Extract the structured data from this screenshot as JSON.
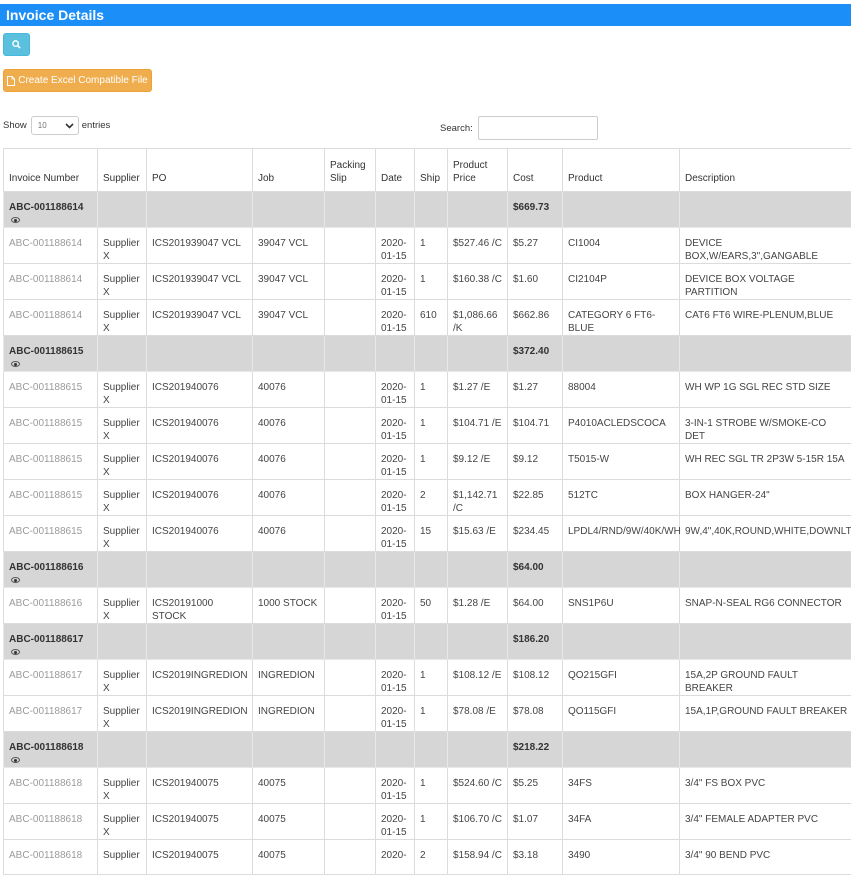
{
  "header": {
    "title": "Invoice Details"
  },
  "toolbar": {
    "excel_label": "Create Excel Compatible File"
  },
  "controls": {
    "show_label": "Show",
    "entries_value": "10",
    "entries_label": "entries",
    "search_label": "Search:"
  },
  "table": {
    "columns": [
      "Invoice Number",
      "Supplier",
      "PO",
      "Job",
      "Packing Slip",
      "Date",
      "Ship",
      "Product Price",
      "Cost",
      "Product",
      "Description"
    ],
    "groups": [
      {
        "invoice": "ABC-001188614",
        "total": "$669.73",
        "rows": [
          [
            "ABC-001188614",
            "Supplier X",
            "ICS201939047 VCL",
            "39047 VCL",
            "",
            "2020-01-15",
            "1",
            "$527.46 /C",
            "$5.27",
            "CI1004",
            "DEVICE BOX,W/EARS,3\",GANGABLE"
          ],
          [
            "ABC-001188614",
            "Supplier X",
            "ICS201939047 VCL",
            "39047 VCL",
            "",
            "2020-01-15",
            "1",
            "$160.38 /C",
            "$1.60",
            "CI2104P",
            "DEVICE BOX VOLTAGE PARTITION"
          ],
          [
            "ABC-001188614",
            "Supplier X",
            "ICS201939047 VCL",
            "39047 VCL",
            "",
            "2020-01-15",
            "610",
            "$1,086.66 /K",
            "$662.86",
            "CATEGORY 6 FT6-BLUE",
            "CAT6 FT6 WIRE-PLENUM,BLUE"
          ]
        ]
      },
      {
        "invoice": "ABC-001188615",
        "total": "$372.40",
        "rows": [
          [
            "ABC-001188615",
            "Supplier X",
            "ICS201940076",
            "40076",
            "",
            "2020-01-15",
            "1",
            "$1.27 /E",
            "$1.27",
            "88004",
            "WH WP 1G SGL REC STD SIZE"
          ],
          [
            "ABC-001188615",
            "Supplier X",
            "ICS201940076",
            "40076",
            "",
            "2020-01-15",
            "1",
            "$104.71 /E",
            "$104.71",
            "P4010ACLEDSCOCA",
            "3-IN-1 STROBE W/SMOKE-CO DET"
          ],
          [
            "ABC-001188615",
            "Supplier X",
            "ICS201940076",
            "40076",
            "",
            "2020-01-15",
            "1",
            "$9.12 /E",
            "$9.12",
            "T5015-W",
            "WH REC SGL TR 2P3W 5-15R 15A"
          ],
          [
            "ABC-001188615",
            "Supplier X",
            "ICS201940076",
            "40076",
            "",
            "2020-01-15",
            "2",
            "$1,142.71 /C",
            "$22.85",
            "512TC",
            "BOX HANGER-24\""
          ],
          [
            "ABC-001188615",
            "Supplier X",
            "ICS201940076",
            "40076",
            "",
            "2020-01-15",
            "15",
            "$15.63 /E",
            "$234.45",
            "LPDL4/RND/9W/40K/WH",
            "9W,4\",40K,ROUND,WHITE,DOWNLT"
          ]
        ]
      },
      {
        "invoice": "ABC-001188616",
        "total": "$64.00",
        "rows": [
          [
            "ABC-001188616",
            "Supplier X",
            "ICS20191000 STOCK",
            "1000 STOCK",
            "",
            "2020-01-15",
            "50",
            "$1.28 /E",
            "$64.00",
            "SNS1P6U",
            "SNAP-N-SEAL RG6 CONNECTOR"
          ]
        ]
      },
      {
        "invoice": "ABC-001188617",
        "total": "$186.20",
        "rows": [
          [
            "ABC-001188617",
            "Supplier X",
            "ICS2019INGREDION",
            "INGREDION",
            "",
            "2020-01-15",
            "1",
            "$108.12 /E",
            "$108.12",
            "QO215GFI",
            "15A,2P GROUND FAULT BREAKER"
          ],
          [
            "ABC-001188617",
            "Supplier X",
            "ICS2019INGREDION",
            "INGREDION",
            "",
            "2020-01-15",
            "1",
            "$78.08 /E",
            "$78.08",
            "QO115GFI",
            "15A,1P,GROUND FAULT BREAKER"
          ]
        ]
      },
      {
        "invoice": "ABC-001188618",
        "total": "$218.22",
        "rows": [
          [
            "ABC-001188618",
            "Supplier X",
            "ICS201940075",
            "40075",
            "",
            "2020-01-15",
            "1",
            "$524.60 /C",
            "$5.25",
            "34FS",
            "3/4\" FS BOX PVC"
          ],
          [
            "ABC-001188618",
            "Supplier X",
            "ICS201940075",
            "40075",
            "",
            "2020-01-15",
            "1",
            "$106.70 /C",
            "$1.07",
            "34FA",
            "3/4\" FEMALE ADAPTER PVC"
          ],
          [
            "ABC-001188618",
            "Supplier",
            "ICS201940075",
            "40075",
            "",
            "2020-",
            "2",
            "$158.94 /C",
            "$3.18",
            "3490",
            "3/4\" 90 BEND PVC"
          ]
        ]
      }
    ]
  }
}
